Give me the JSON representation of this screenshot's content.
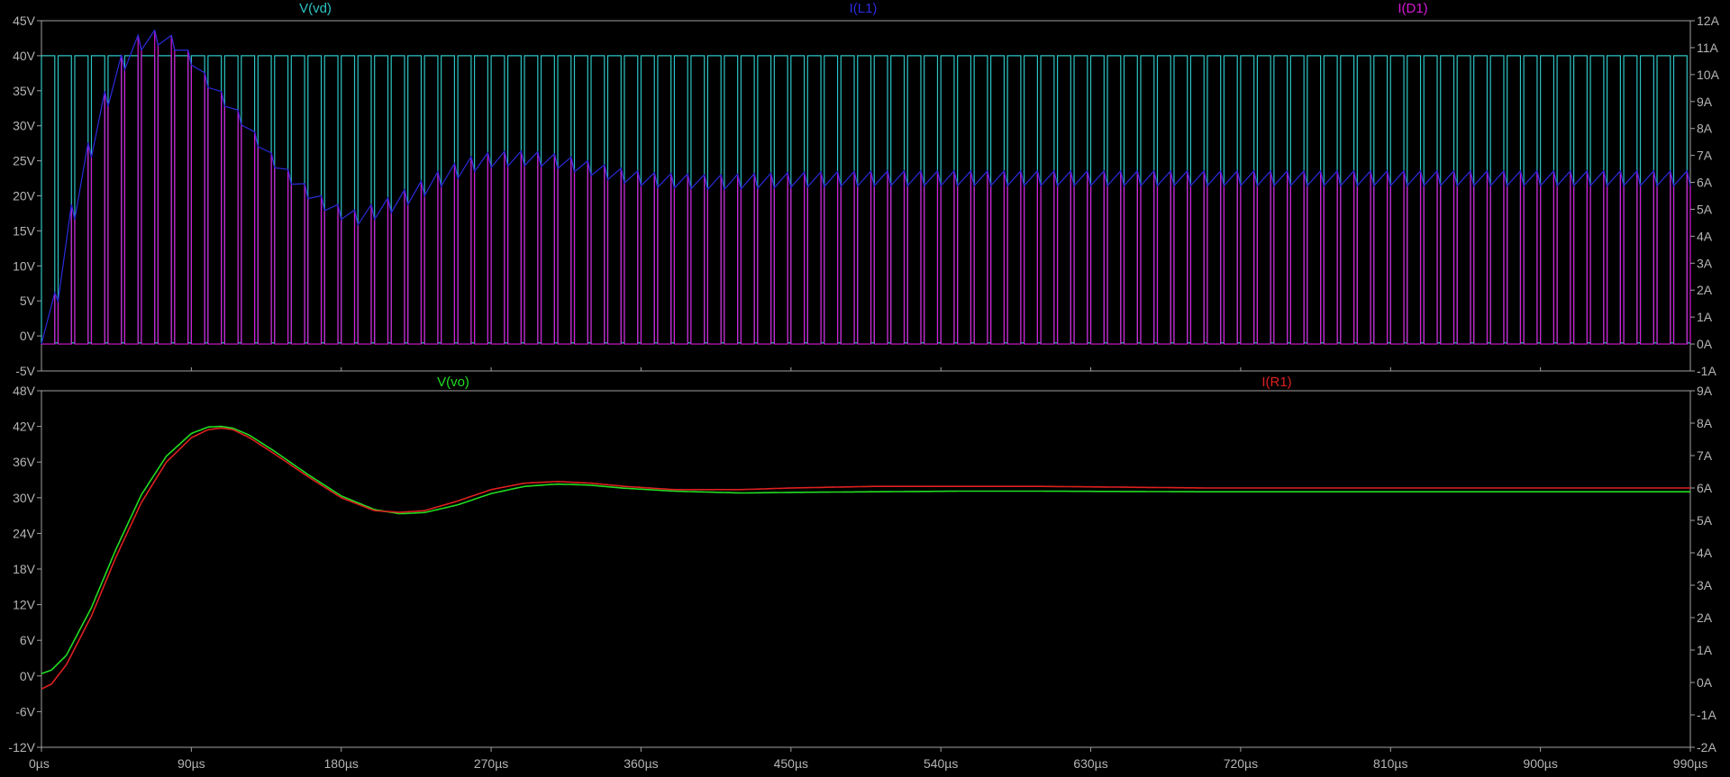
{
  "chart_data": [
    {
      "type": "line",
      "panel": "top",
      "x_axis": {
        "range_us": [
          0,
          990
        ],
        "ticks": [
          0,
          90,
          180,
          270,
          360,
          450,
          540,
          630,
          720,
          810,
          900,
          990
        ],
        "tick_labels": [
          "0µs",
          "90µs",
          "180µs",
          "270µs",
          "360µs",
          "450µs",
          "540µs",
          "630µs",
          "720µs",
          "810µs",
          "900µs",
          "990µs"
        ]
      },
      "left_axis": {
        "range": [
          -5,
          45
        ],
        "ticks": [
          -5,
          0,
          5,
          10,
          15,
          20,
          25,
          30,
          35,
          40,
          45
        ],
        "tick_labels": [
          "-5V",
          "0V",
          "5V",
          "10V",
          "15V",
          "20V",
          "25V",
          "30V",
          "35V",
          "40V",
          "45V"
        ]
      },
      "right_axis": {
        "range": [
          -1,
          12
        ],
        "ticks": [
          -1,
          0,
          1,
          2,
          3,
          4,
          5,
          6,
          7,
          8,
          9,
          10,
          11,
          12
        ],
        "tick_labels": [
          "-1A",
          "0A",
          "1A",
          "2A",
          "3A",
          "4A",
          "5A",
          "6A",
          "7A",
          "8A",
          "9A",
          "10A",
          "11A",
          "12A"
        ]
      },
      "grid": false,
      "switching": {
        "period_us": 10,
        "duty": 0.8,
        "pulse_high_V": 40,
        "pulse_low_V": -1
      },
      "series": [
        {
          "name": "V(vd)",
          "axis": "left",
          "color": "#2ec4c4",
          "kind": "pwm-pulse",
          "low_V": -1,
          "high_V": 40
        },
        {
          "name": "I(L1)",
          "axis": "right",
          "color": "#2b2bdd",
          "kind": "sawtooth-envelope",
          "envelope_x_us": [
            0,
            8,
            18,
            30,
            40,
            52,
            62,
            72,
            82,
            92,
            105,
            118,
            132,
            150,
            170,
            185,
            200,
            220,
            240,
            260,
            280,
            300,
            320,
            340,
            360,
            400,
            450,
            500,
            600,
            700,
            800,
            900,
            990
          ],
          "envelope_y_A": [
            0,
            2.8,
            5.8,
            8.2,
            10.0,
            11.1,
            11.4,
            11.3,
            10.9,
            10.0,
            9.1,
            8.2,
            7.0,
            5.9,
            5.0,
            4.7,
            5.0,
            5.6,
            6.3,
            6.8,
            6.9,
            6.85,
            6.6,
            6.3,
            6.1,
            6.0,
            6.1,
            6.15,
            6.15,
            6.15,
            6.15,
            6.15,
            6.15
          ],
          "ripple_A": 0.55
        },
        {
          "name": "I(D1)",
          "axis": "right",
          "color": "#d619d6",
          "kind": "diode-pulse",
          "low_A": 0,
          "note_envelope": "I(L1)"
        }
      ]
    },
    {
      "type": "line",
      "panel": "bottom",
      "x_axis": {
        "range_us": [
          0,
          990
        ],
        "ticks": [
          0,
          90,
          180,
          270,
          360,
          450,
          540,
          630,
          720,
          810,
          900,
          990
        ],
        "tick_labels": [
          "0µs",
          "90µs",
          "180µs",
          "270µs",
          "360µs",
          "450µs",
          "540µs",
          "630µs",
          "720µs",
          "810µs",
          "900µs",
          "990µs"
        ]
      },
      "left_axis": {
        "range": [
          -12,
          48
        ],
        "ticks": [
          -12,
          -6,
          0,
          6,
          12,
          18,
          24,
          30,
          36,
          42,
          48
        ],
        "tick_labels": [
          "-12V",
          "-6V",
          "0V",
          "6V",
          "12V",
          "18V",
          "24V",
          "30V",
          "36V",
          "42V",
          "48V"
        ]
      },
      "right_axis": {
        "range": [
          -2,
          9
        ],
        "ticks": [
          -2,
          -1,
          0,
          1,
          2,
          3,
          4,
          5,
          6,
          7,
          8,
          9
        ],
        "tick_labels": [
          "-2A",
          "-1A",
          "0A",
          "1A",
          "2A",
          "3A",
          "4A",
          "5A",
          "6A",
          "7A",
          "8A",
          "9A"
        ]
      },
      "grid": false,
      "series": [
        {
          "name": "V(vo)",
          "axis": "left",
          "color": "#22dd22",
          "x_us": [
            0,
            6,
            15,
            30,
            45,
            60,
            75,
            90,
            100,
            108,
            115,
            125,
            140,
            160,
            180,
            200,
            215,
            230,
            250,
            270,
            290,
            310,
            330,
            350,
            380,
            420,
            450,
            500,
            550,
            600,
            700,
            800,
            900,
            990
          ],
          "y": [
            0.4,
            1.0,
            3.5,
            11.5,
            21.5,
            30.5,
            37.0,
            40.8,
            41.9,
            42.0,
            41.7,
            40.5,
            37.8,
            33.9,
            30.3,
            28.0,
            27.3,
            27.5,
            28.8,
            30.7,
            31.9,
            32.3,
            32.1,
            31.6,
            31.1,
            30.8,
            30.9,
            31.0,
            31.1,
            31.1,
            31.0,
            31.0,
            31.0,
            31.0
          ]
        },
        {
          "name": "I(R1)",
          "axis": "right",
          "color": "#dd2020",
          "x_us": [
            0,
            6,
            15,
            30,
            45,
            60,
            75,
            90,
            100,
            108,
            115,
            125,
            140,
            160,
            180,
            200,
            215,
            230,
            250,
            270,
            290,
            310,
            330,
            350,
            380,
            420,
            450,
            500,
            550,
            600,
            700,
            800,
            900,
            990
          ],
          "y": [
            -0.2,
            -0.05,
            0.55,
            2.05,
            3.9,
            5.55,
            6.8,
            7.55,
            7.8,
            7.85,
            7.8,
            7.55,
            7.05,
            6.35,
            5.7,
            5.3,
            5.25,
            5.3,
            5.6,
            5.95,
            6.15,
            6.2,
            6.15,
            6.05,
            5.95,
            5.95,
            6.0,
            6.05,
            6.05,
            6.05,
            6.0,
            6.0,
            6.0,
            6.0
          ]
        }
      ]
    }
  ],
  "legend_labels": {
    "top": [
      "V(vd)",
      "I(L1)",
      "I(D1)"
    ],
    "bottom": [
      "V(vo)",
      "I(R1)"
    ]
  },
  "colors": {
    "background": "#000000",
    "frame": "#a0a0a0",
    "tick_text": "#b4b4b4"
  }
}
